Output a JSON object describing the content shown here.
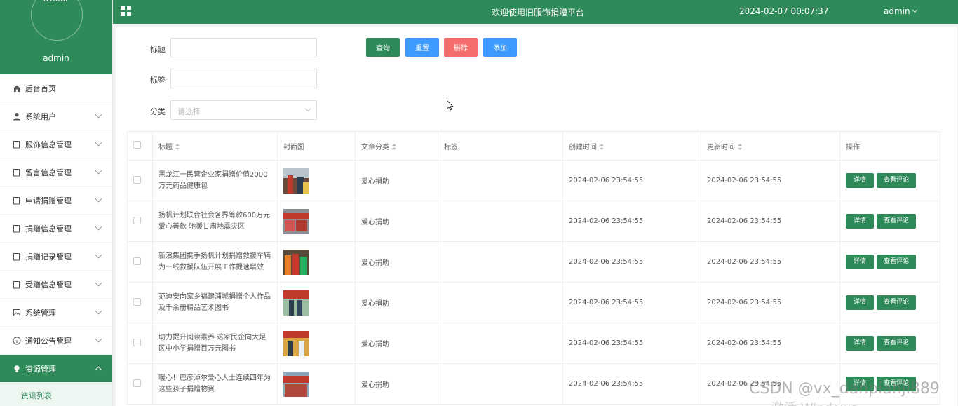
{
  "sidebar": {
    "avatar_alt": "avatar",
    "username": "admin",
    "items": [
      {
        "label": "后台首页",
        "icon": "home-icon",
        "expandable": false
      },
      {
        "label": "系统用户",
        "icon": "user-icon",
        "expandable": true
      },
      {
        "label": "服饰信息管理",
        "icon": "document-icon",
        "expandable": true
      },
      {
        "label": "留言信息管理",
        "icon": "document-icon",
        "expandable": true
      },
      {
        "label": "申请捐赠管理",
        "icon": "document-icon",
        "expandable": true
      },
      {
        "label": "捐赠信息管理",
        "icon": "document-icon",
        "expandable": true
      },
      {
        "label": "捐赠记录管理",
        "icon": "document-icon",
        "expandable": true
      },
      {
        "label": "受赠信息管理",
        "icon": "document-icon",
        "expandable": true
      },
      {
        "label": "系统管理",
        "icon": "picture-icon",
        "expandable": true
      },
      {
        "label": "通知公告管理",
        "icon": "info-icon",
        "expandable": true
      },
      {
        "label": "资源管理",
        "icon": "bulb-icon",
        "expandable": true,
        "active": true
      }
    ],
    "sub_items": [
      {
        "label": "资讯列表"
      }
    ]
  },
  "header": {
    "title": "欢迎使用旧服饰捐赠平台",
    "datetime": "2024-02-07 00:07:37",
    "user": "admin"
  },
  "filters": {
    "title_label": "标题",
    "tag_label": "标签",
    "category_label": "分类",
    "category_placeholder": "请选择",
    "title_value": "",
    "tag_value": ""
  },
  "buttons": {
    "search": "查询",
    "reset": "重置",
    "delete": "删除",
    "add": "添加"
  },
  "table": {
    "headers": [
      "标题",
      "封面图",
      "文章分类",
      "标签",
      "创建时间",
      "更新时间",
      "操作"
    ],
    "detail_label": "详情",
    "comments_label": "查看评论",
    "rows": [
      {
        "title": "黑龙江一民营企业家捐赠价值2000万元药品健康包",
        "category": "爱心捐助",
        "tag": "",
        "created": "2024-02-06 23:54:55",
        "updated": "2024-02-06 23:54:55"
      },
      {
        "title": "扬帆计划联合社会各界筹款600万元爱心善款 驰援甘肃地震灾区",
        "category": "爱心捐助",
        "tag": "",
        "created": "2024-02-06 23:54:55",
        "updated": "2024-02-06 23:54:55"
      },
      {
        "title": "新浪集团携手扬帆计划捐赠救援车辆为一线救援队伍开展工作提速增效",
        "category": "爱心捐助",
        "tag": "",
        "created": "2024-02-06 23:54:55",
        "updated": "2024-02-06 23:54:55"
      },
      {
        "title": "范迪安向家乡福建浦城捐赠个人作品及千余册精品艺术图书",
        "category": "爱心捐助",
        "tag": "",
        "created": "2024-02-06 23:54:55",
        "updated": "2024-02-06 23:54:55"
      },
      {
        "title": "助力提升阅读素养 这家民企向大足区中小学捐赠百万元图书",
        "category": "爱心捐助",
        "tag": "",
        "created": "2024-02-06 23:54:55",
        "updated": "2024-02-06 23:54:55"
      },
      {
        "title": "暖心！巴彦淖尔爱心人士连续四年为这些孩子捐赠物资",
        "category": "爱心捐助",
        "tag": "",
        "created": "2024-02-06 23:54:55",
        "updated": "2024-02-06 23:54:55"
      }
    ]
  },
  "watermark": {
    "text": "CSDN @vx_danpianji889",
    "text2": "激活 Windows"
  },
  "colors": {
    "primary": "#2f8a5a",
    "blue": "#3d9bff",
    "red": "#f56c6c"
  }
}
